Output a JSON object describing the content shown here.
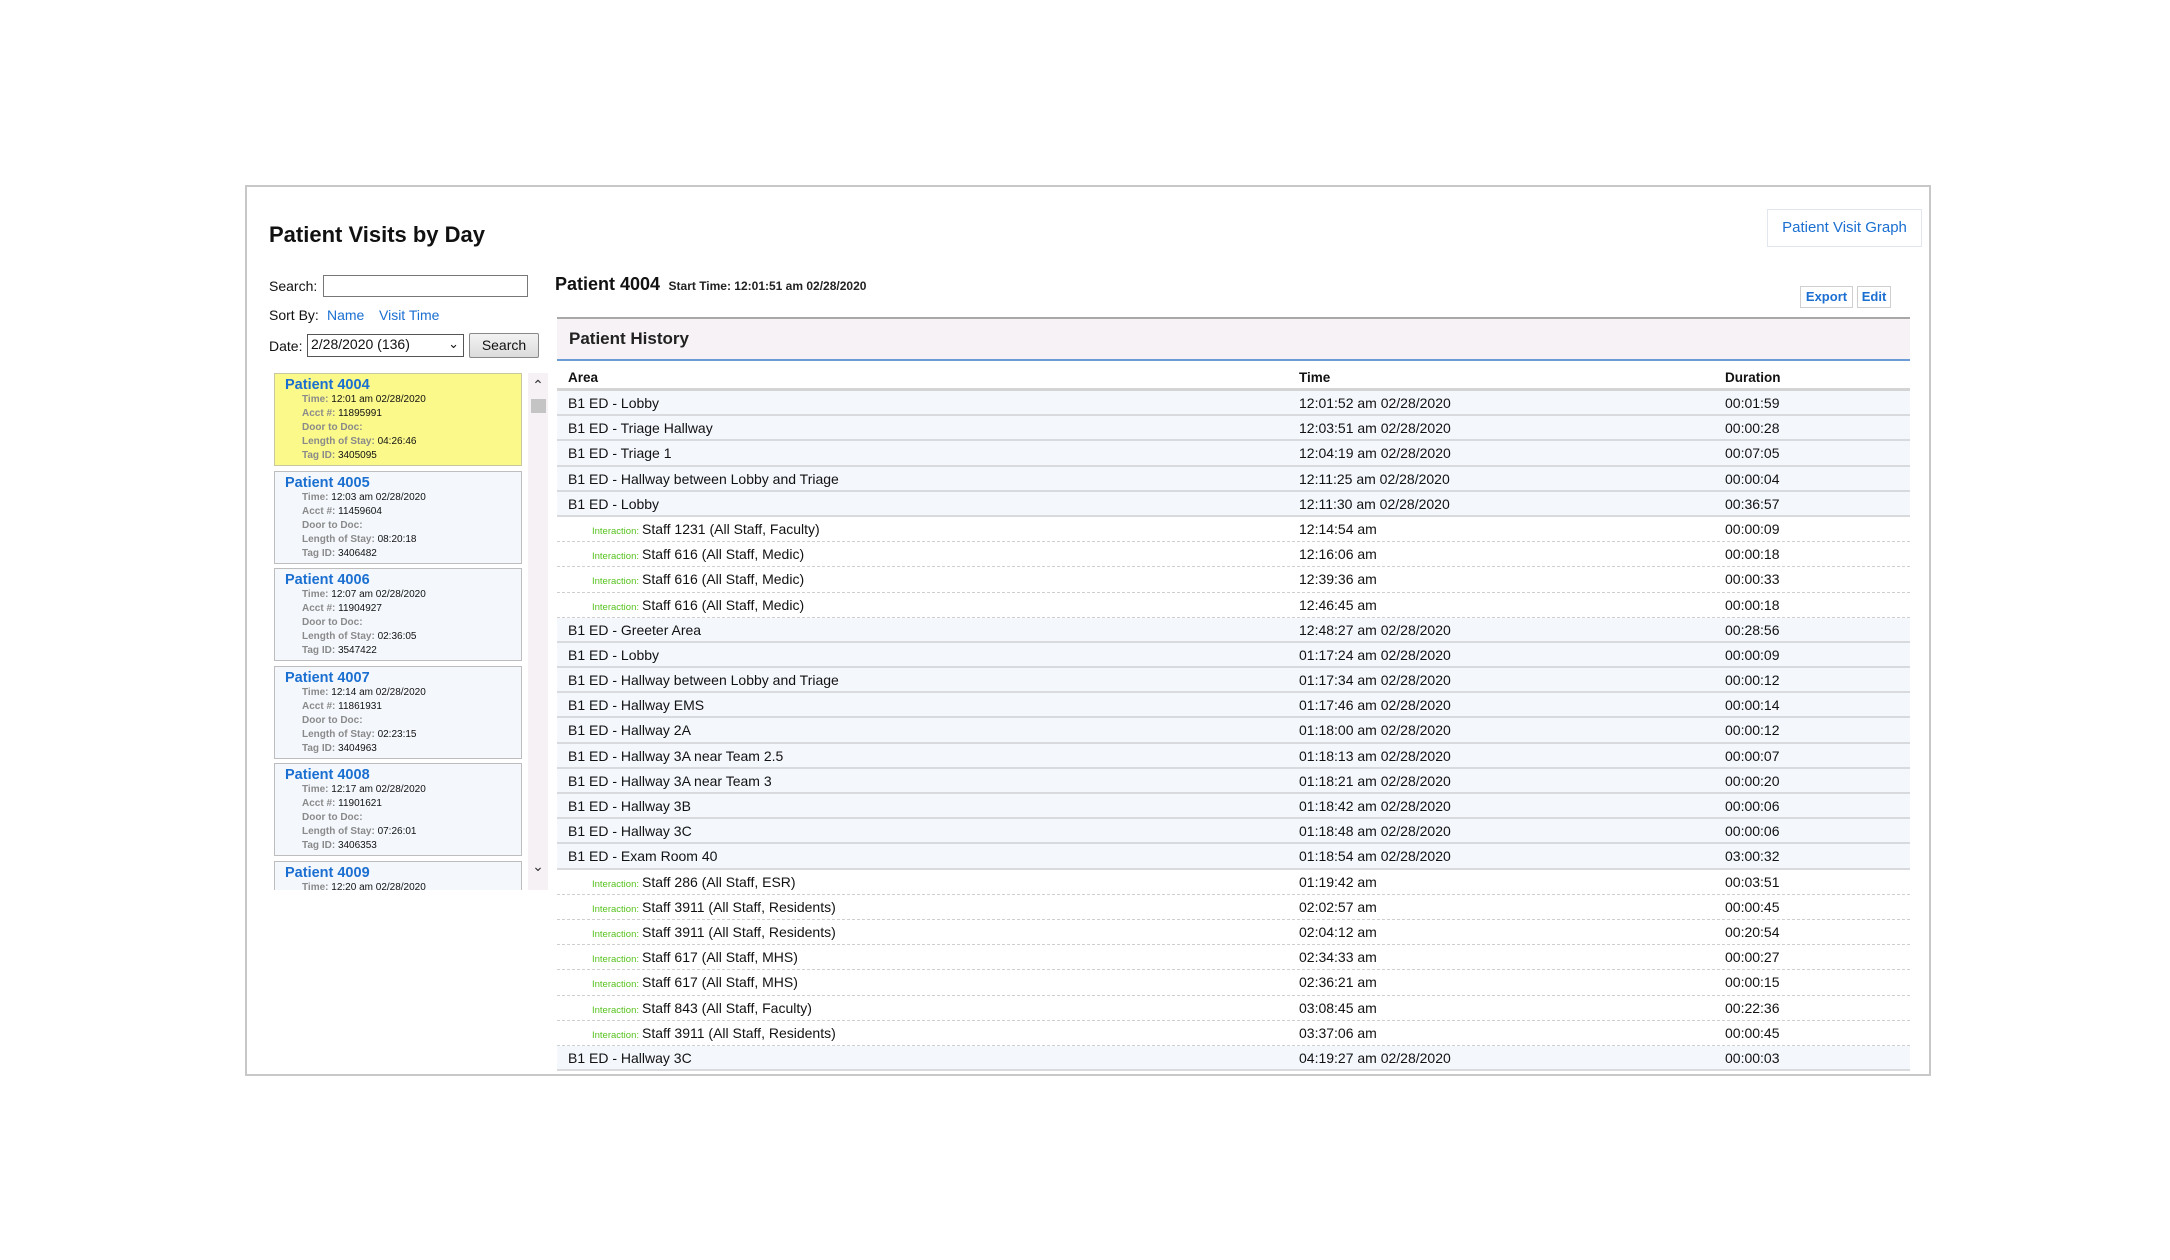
{
  "header": {
    "title": "Patient Visits by Day",
    "graph_button": "Patient Visit Graph"
  },
  "filters": {
    "search_label": "Search:",
    "search_value": "",
    "search_placeholder": "",
    "sort_label": "Sort By:",
    "sort_options": [
      "Name",
      "Visit Time"
    ],
    "date_label": "Date:",
    "date_selected": "2/28/2020 (136)",
    "search_button": "Search"
  },
  "field_labels": {
    "time": "Time:",
    "acct": "Acct #:",
    "door": "Door to Doc:",
    "los": "Length of Stay:",
    "tag": "Tag ID:"
  },
  "patients": [
    {
      "name": "Patient 4004",
      "time": "12:01 am 02/28/2020",
      "acct": "11895991",
      "door_to_doc": "",
      "length_of_stay": "04:26:46",
      "tag_id": "3405095",
      "selected": true
    },
    {
      "name": "Patient 4005",
      "time": "12:03 am 02/28/2020",
      "acct": "11459604",
      "door_to_doc": "",
      "length_of_stay": "08:20:18",
      "tag_id": "3406482",
      "selected": false
    },
    {
      "name": "Patient 4006",
      "time": "12:07 am 02/28/2020",
      "acct": "11904927",
      "door_to_doc": "",
      "length_of_stay": "02:36:05",
      "tag_id": "3547422",
      "selected": false
    },
    {
      "name": "Patient 4007",
      "time": "12:14 am 02/28/2020",
      "acct": "11861931",
      "door_to_doc": "",
      "length_of_stay": "02:23:15",
      "tag_id": "3404963",
      "selected": false
    },
    {
      "name": "Patient 4008",
      "time": "12:17 am 02/28/2020",
      "acct": "11901621",
      "door_to_doc": "",
      "length_of_stay": "07:26:01",
      "tag_id": "3406353",
      "selected": false
    },
    {
      "name": "Patient 4009",
      "time": "12:20 am 02/28/2020",
      "acct": "",
      "door_to_doc": "",
      "length_of_stay": "",
      "tag_id": "",
      "selected": false
    }
  ],
  "detail": {
    "patient_name": "Patient 4004",
    "start_time": "Start Time: 12:01:51 am 02/28/2020",
    "export_button": "Export",
    "edit_button": "Edit",
    "section_title": "Patient History",
    "columns": [
      "Area",
      "Time",
      "Duration"
    ],
    "interaction_label": "Interaction:",
    "rows": [
      {
        "type": "area",
        "area": "B1 ED - Lobby",
        "time": "12:01:52 am 02/28/2020",
        "duration": "00:01:59"
      },
      {
        "type": "area",
        "area": "B1 ED - Triage Hallway",
        "time": "12:03:51 am 02/28/2020",
        "duration": "00:00:28"
      },
      {
        "type": "area",
        "area": "B1 ED - Triage 1",
        "time": "12:04:19 am 02/28/2020",
        "duration": "00:07:05"
      },
      {
        "type": "area",
        "area": "B1 ED - Hallway between Lobby and Triage",
        "time": "12:11:25 am 02/28/2020",
        "duration": "00:00:04"
      },
      {
        "type": "area",
        "area": "B1 ED - Lobby",
        "time": "12:11:30 am 02/28/2020",
        "duration": "00:36:57"
      },
      {
        "type": "interaction",
        "area": "Staff 1231 (All Staff, Faculty)",
        "time": "12:14:54 am",
        "duration": "00:00:09"
      },
      {
        "type": "interaction",
        "area": "Staff 616 (All Staff, Medic)",
        "time": "12:16:06 am",
        "duration": "00:00:18"
      },
      {
        "type": "interaction",
        "area": "Staff 616 (All Staff, Medic)",
        "time": "12:39:36 am",
        "duration": "00:00:33"
      },
      {
        "type": "interaction",
        "area": "Staff 616 (All Staff, Medic)",
        "time": "12:46:45 am",
        "duration": "00:00:18"
      },
      {
        "type": "area",
        "area": "B1 ED - Greeter Area",
        "time": "12:48:27 am 02/28/2020",
        "duration": "00:28:56"
      },
      {
        "type": "area",
        "area": "B1 ED - Lobby",
        "time": "01:17:24 am 02/28/2020",
        "duration": "00:00:09"
      },
      {
        "type": "area",
        "area": "B1 ED - Hallway between Lobby and Triage",
        "time": "01:17:34 am 02/28/2020",
        "duration": "00:00:12"
      },
      {
        "type": "area",
        "area": "B1 ED - Hallway EMS",
        "time": "01:17:46 am 02/28/2020",
        "duration": "00:00:14"
      },
      {
        "type": "area",
        "area": "B1 ED - Hallway 2A",
        "time": "01:18:00 am 02/28/2020",
        "duration": "00:00:12"
      },
      {
        "type": "area",
        "area": "B1 ED - Hallway 3A near Team 2.5",
        "time": "01:18:13 am 02/28/2020",
        "duration": "00:00:07"
      },
      {
        "type": "area",
        "area": "B1 ED - Hallway 3A near Team 3",
        "time": "01:18:21 am 02/28/2020",
        "duration": "00:00:20"
      },
      {
        "type": "area",
        "area": "B1 ED - Hallway 3B",
        "time": "01:18:42 am 02/28/2020",
        "duration": "00:00:06"
      },
      {
        "type": "area",
        "area": "B1 ED - Hallway 3C",
        "time": "01:18:48 am 02/28/2020",
        "duration": "00:00:06"
      },
      {
        "type": "area",
        "area": "B1 ED - Exam Room 40",
        "time": "01:18:54 am 02/28/2020",
        "duration": "03:00:32"
      },
      {
        "type": "interaction",
        "area": "Staff 286 (All Staff, ESR)",
        "time": "01:19:42 am",
        "duration": "00:03:51"
      },
      {
        "type": "interaction",
        "area": "Staff 3911 (All Staff, Residents)",
        "time": "02:02:57 am",
        "duration": "00:00:45"
      },
      {
        "type": "interaction",
        "area": "Staff 3911 (All Staff, Residents)",
        "time": "02:04:12 am",
        "duration": "00:20:54"
      },
      {
        "type": "interaction",
        "area": "Staff 617 (All Staff, MHS)",
        "time": "02:34:33 am",
        "duration": "00:00:27"
      },
      {
        "type": "interaction",
        "area": "Staff 617 (All Staff, MHS)",
        "time": "02:36:21 am",
        "duration": "00:00:15"
      },
      {
        "type": "interaction",
        "area": "Staff 843 (All Staff, Faculty)",
        "time": "03:08:45 am",
        "duration": "00:22:36"
      },
      {
        "type": "interaction",
        "area": "Staff 3911 (All Staff, Residents)",
        "time": "03:37:06 am",
        "duration": "00:00:45"
      },
      {
        "type": "area",
        "area": "B1 ED - Hallway 3C",
        "time": "04:19:27 am 02/28/2020",
        "duration": "00:00:03"
      }
    ]
  },
  "icons": {
    "select_chevron": "chevron-down-icon",
    "scroll_up": "chevron-up-icon",
    "scroll_down": "chevron-down-icon"
  },
  "colors": {
    "link": "#1a6fd1",
    "selected_card": "#fbf98a",
    "interaction_label": "#57c21e",
    "header_underline": "#6b9cd6"
  }
}
